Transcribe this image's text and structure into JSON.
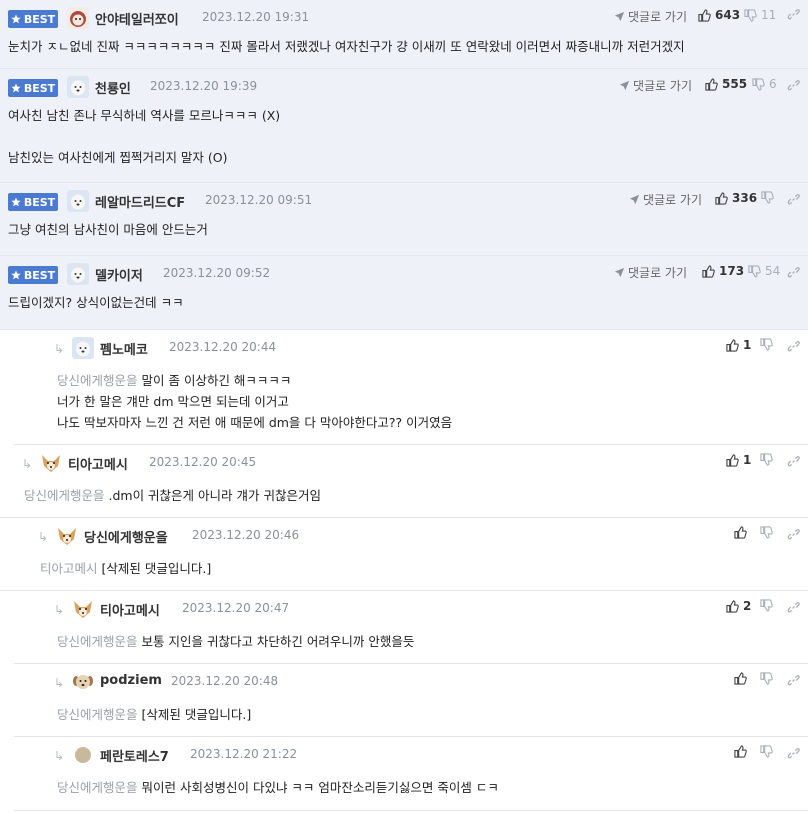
{
  "best_label": "BEST",
  "reply_link_label": "댓글로 가기",
  "comments": [
    {
      "nick": "안야테일러쪼이",
      "date": "2023.12.20 19:31",
      "likes": "643",
      "dislikes": "11",
      "lines": [
        "눈치가 ㅈㄴ없네 진짜 ㅋㅋㅋㅋㅋㅋㅋㅋ 진짜 몰라서 저랬겠나 여자친구가 걍 이새끼 또 연락왔네 이러면서 짜증내니까 저런거겠지"
      ]
    },
    {
      "nick": "천룡인",
      "date": "2023.12.20 19:39",
      "likes": "555",
      "dislikes": "6",
      "lines": [
        "여사친 남친 존나 무식하네 역사를 모르나ㅋㅋㅋ (X)",
        "",
        "남친있는 여사친에게 찝쩍거리지 말자 (O)"
      ]
    },
    {
      "nick": "레알마드리드CF",
      "date": "2023.12.20 09:51",
      "likes": "336",
      "dislikes": "",
      "lines": [
        "그냥 여친의 남사친이 마음에 안드는거"
      ]
    },
    {
      "nick": "델카이저",
      "date": "2023.12.20 09:52",
      "likes": "173",
      "dislikes": "54",
      "lines": [
        "드립이겠지? 상식이없는건데 ㅋㅋ"
      ]
    }
  ],
  "replies": [
    {
      "nick": "펨노메코",
      "date": "2023.12.20 20:44",
      "likes": "1",
      "mention": "당신에게행운을",
      "lines": [
        "말이 좀 이상하긴 해ㅋㅋㅋㅋ",
        "너가 한 말은 걔만 dm 막으면 되는데 이거고",
        "나도 딱보자마자 느낀 건 저런 애 때문에 dm을 다 막아야한다고?? 이거였음"
      ]
    },
    {
      "nick": "티아고메시",
      "date": "2023.12.20 20:45",
      "likes": "1",
      "mention": "당신에게행운을",
      "lines": [
        ".dm이 귀찮은게 아니라 걔가 귀찮은거임"
      ]
    },
    {
      "nick": "당신에게행운을",
      "date": "2023.12.20 20:46",
      "likes": "",
      "mention": "티아고메시",
      "lines": [
        "[삭제된 댓글입니다.]"
      ]
    },
    {
      "nick": "티아고메시",
      "date": "2023.12.20 20:47",
      "likes": "2",
      "mention": "당신에게행운을",
      "lines": [
        "보통 지인을 귀찮다고 차단하긴 어려우니까 안했을듯"
      ]
    },
    {
      "nick": "podziem",
      "date": "2023.12.20 20:48",
      "likes": "",
      "mention": "당신에게행운을",
      "lines": [
        "[삭제된 댓글입니다.]"
      ]
    },
    {
      "nick": "페란토레스7",
      "date": "2023.12.20 21:22",
      "likes": "",
      "mention": "당신에게행운을",
      "lines": [
        "뭐이런 사회성병신이 다있냐 ㅋㅋ 엄마잔소리듣기싫으면 죽이셈 ㄷㅋ"
      ]
    }
  ],
  "colors": {
    "best_bg": "#eef2f8",
    "badge": "#4a7bd0",
    "mention": "#9aa1a9"
  }
}
